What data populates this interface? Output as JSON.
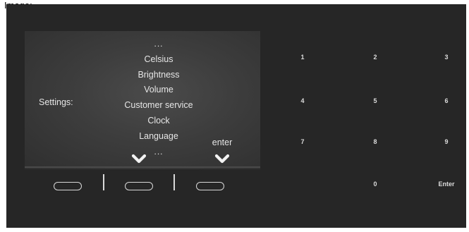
{
  "heading": "Image:",
  "display": {
    "settings_label": "Settings:",
    "menu_items": [
      "...",
      "Celsius",
      "Brightness",
      "Volume",
      "Customer service",
      "Clock",
      "Language",
      "..."
    ],
    "enter_label": "enter",
    "text_color": "#e6e6e6"
  },
  "keypad": {
    "keys": [
      "1",
      "2",
      "3",
      "4",
      "5",
      "6",
      "7",
      "8",
      "9",
      "0",
      "Enter"
    ]
  },
  "icons": {
    "scroll_down": "chevron-down-icon",
    "enter": "chevron-down-icon"
  },
  "colors": {
    "background": "#262626",
    "screen": "#3d3d3d",
    "text": "#e6e6e6"
  }
}
